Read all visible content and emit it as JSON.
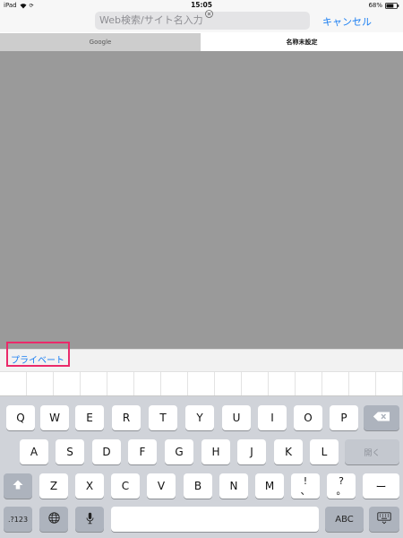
{
  "status_bar": {
    "device": "iPad",
    "time": "15:05",
    "battery": "68%"
  },
  "search": {
    "placeholder": "Web検索/サイト名入力",
    "cancel_label": "キャンセル"
  },
  "tabs": [
    {
      "label": "Google",
      "active": false
    },
    {
      "label": "名称未設定",
      "active": true
    }
  ],
  "private_label": "プライベート",
  "keyboard": {
    "row1": [
      "Q",
      "W",
      "E",
      "R",
      "T",
      "Y",
      "U",
      "I",
      "O",
      "P"
    ],
    "row2": [
      "A",
      "S",
      "D",
      "F",
      "G",
      "H",
      "J",
      "K",
      "L"
    ],
    "row3": [
      "Z",
      "X",
      "C",
      "V",
      "B",
      "N",
      "M"
    ],
    "comma_top": "!",
    "comma_bottom": "、",
    "period_top": "?",
    "period_bottom": "。",
    "dash": "ー",
    "backspace_icon": "backspace-icon",
    "return_label": "開く",
    "shift_icon": "shift-up-icon",
    "numbers_label": ".?123",
    "globe_icon": "globe-icon",
    "mic_icon": "microphone-icon",
    "space_label": "",
    "abc_label": "ABC",
    "dismiss_icon": "keyboard-dismiss-icon"
  },
  "colors": {
    "accent": "#1a7ef2",
    "highlight": "#ea2a6a",
    "content_bg": "#9a9a9a"
  }
}
